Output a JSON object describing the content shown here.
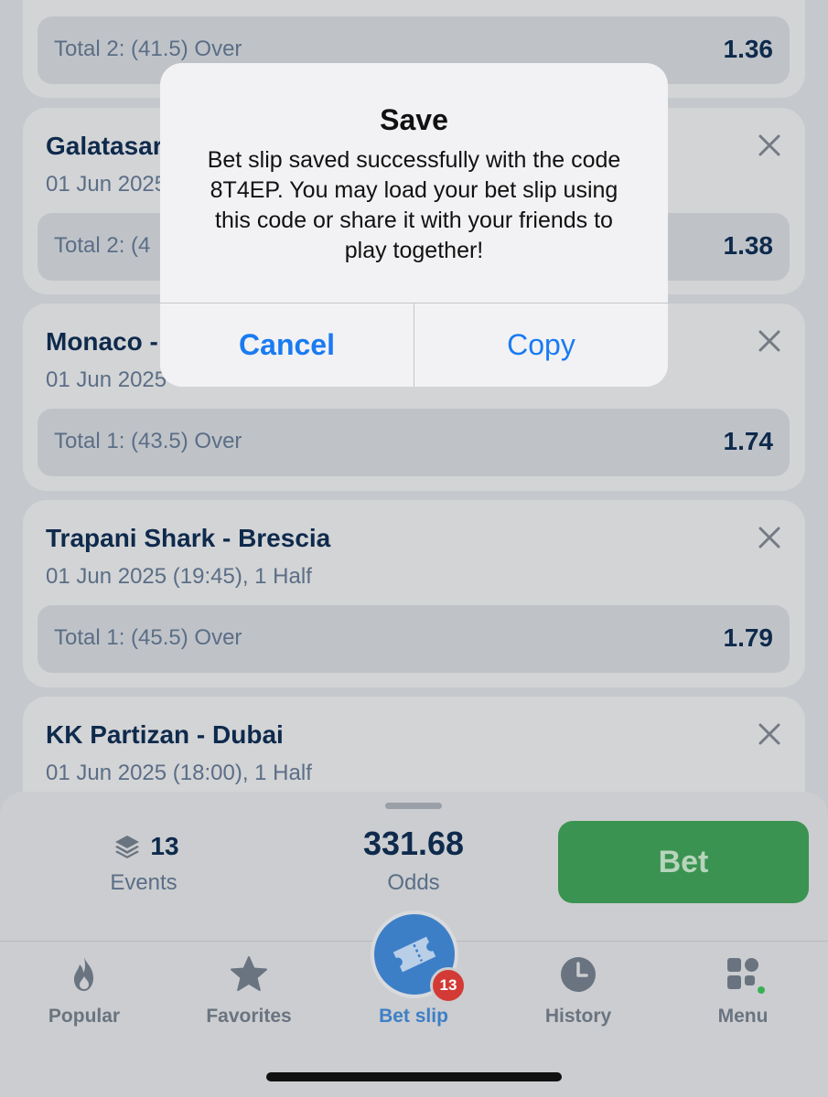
{
  "bets": [
    {
      "title": "",
      "subtitle": "",
      "pick": "Total 2: (41.5) Over",
      "odd": "1.36"
    },
    {
      "title": "Galatasaray",
      "subtitle": "01 Jun 2025",
      "pick": "Total 2: (4",
      "odd": "1.38"
    },
    {
      "title": "Monaco -",
      "subtitle": "01 Jun 2025",
      "pick": "Total 1: (43.5) Over",
      "odd": "1.74"
    },
    {
      "title": "Trapani Shark - Brescia",
      "subtitle": "01 Jun 2025 (19:45), 1 Half",
      "pick": "Total 1: (45.5) Over",
      "odd": "1.79"
    },
    {
      "title": "KK Partizan - Dubai",
      "subtitle": "01 Jun 2025 (18:00), 1 Half",
      "pick": "",
      "odd": ""
    }
  ],
  "betbar": {
    "events_count": "13",
    "events_label": "Events",
    "odds_value": "331.68",
    "odds_label": "Odds",
    "bet_label": "Bet"
  },
  "tabs": {
    "popular": "Popular",
    "favorites": "Favorites",
    "betslip": "Bet slip",
    "history": "History",
    "menu": "Menu",
    "betslip_badge": "13"
  },
  "alert": {
    "title": "Save",
    "message": "Bet slip saved successfully with the code 8T4EP. You may load your bet slip using this code or share it with your friends to play together!",
    "cancel_label": "Cancel",
    "copy_label": "Copy"
  },
  "colors": {
    "accent_blue": "#3d7fc7",
    "bet_green": "#3a9350",
    "badge_red": "#d33a36",
    "alert_link": "#1a7bf1"
  },
  "icons": {
    "close": "close-icon",
    "events": "layers-icon",
    "popular": "flame-icon",
    "favorites": "star-icon",
    "betslip": "ticket-icon",
    "history": "clock-icon",
    "menu": "grid-icon"
  }
}
